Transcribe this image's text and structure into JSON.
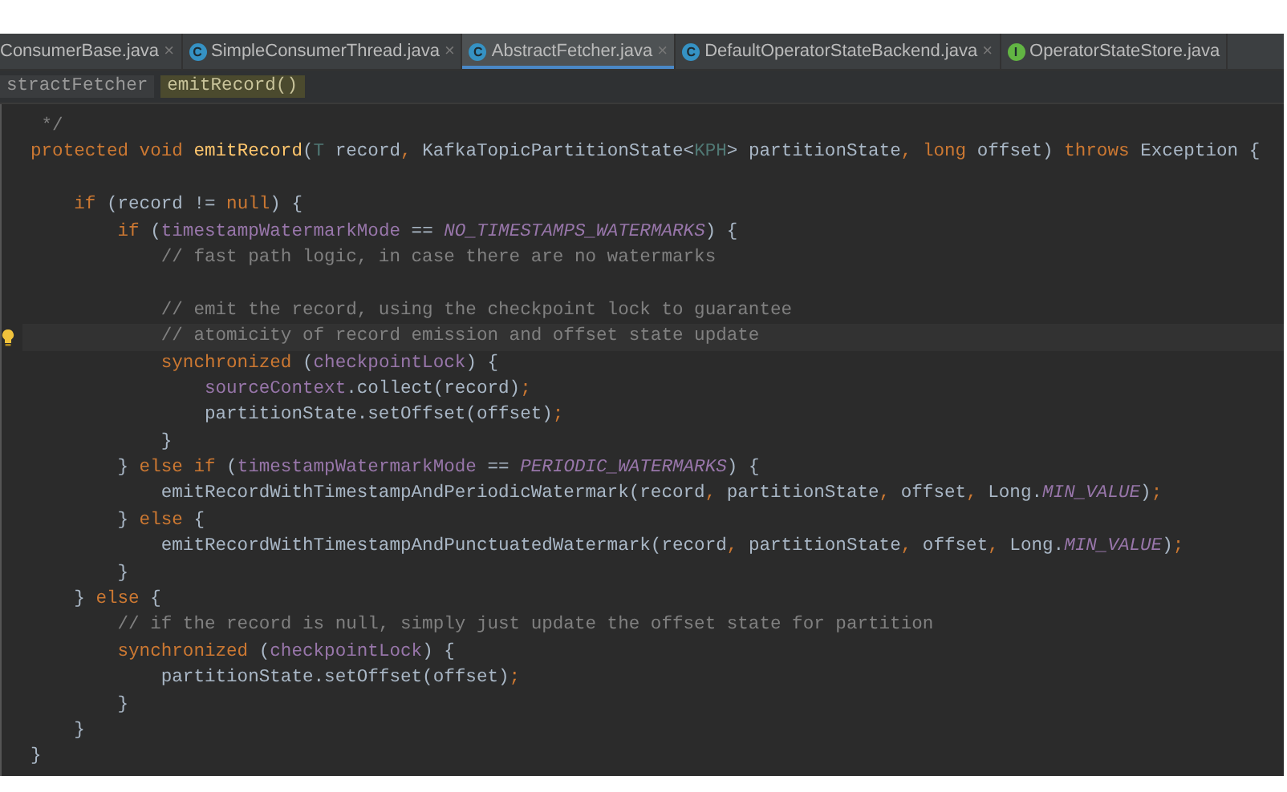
{
  "tabs": [
    {
      "label": "ConsumerBase.java",
      "kind": "plain",
      "close": "×",
      "selected": false
    },
    {
      "label": "SimpleConsumerThread.java",
      "kind": "class",
      "icon": "C",
      "close": "×",
      "selected": false
    },
    {
      "label": "AbstractFetcher.java",
      "kind": "class",
      "icon": "C",
      "close": "×",
      "selected": true
    },
    {
      "label": "DefaultOperatorStateBackend.java",
      "kind": "class",
      "icon": "C",
      "close": "×",
      "selected": false
    },
    {
      "label": "OperatorStateStore.java",
      "kind": "interface",
      "icon": "I",
      "selected": false
    }
  ],
  "breadcrumb": [
    {
      "label": "stractFetcher",
      "selected": false
    },
    {
      "label": "emitRecord()",
      "selected": true
    }
  ],
  "code": {
    "lines": [
      {
        "kind": "code",
        "tokens": [
          {
            "kind": "comment",
            "text": " */"
          }
        ]
      },
      {
        "kind": "code",
        "tokens": [
          {
            "kind": "kw",
            "text": "protected void "
          },
          {
            "kind": "decl",
            "text": "emitRecord"
          },
          {
            "kind": "plain",
            "text": "("
          },
          {
            "kind": "param",
            "text": "T"
          },
          {
            "kind": "plain",
            "text": " record"
          },
          {
            "kind": "punct",
            "text": ", "
          },
          {
            "kind": "plain",
            "text": "KafkaTopicPartitionState<"
          },
          {
            "kind": "param",
            "text": "KPH"
          },
          {
            "kind": "plain",
            "text": "> partitionState"
          },
          {
            "kind": "punct",
            "text": ", "
          },
          {
            "kind": "kw",
            "text": "long "
          },
          {
            "kind": "plain",
            "text": "offset) "
          },
          {
            "kind": "kw",
            "text": "throws "
          },
          {
            "kind": "plain",
            "text": "Exception {"
          }
        ]
      },
      {
        "kind": "blank"
      },
      {
        "kind": "code",
        "tokens": [
          {
            "kind": "kw",
            "text": "    if "
          },
          {
            "kind": "plain",
            "text": "(record != "
          },
          {
            "kind": "kw",
            "text": "null"
          },
          {
            "kind": "plain",
            "text": ") {"
          }
        ]
      },
      {
        "kind": "code",
        "tokens": [
          {
            "kind": "kw",
            "text": "        if "
          },
          {
            "kind": "plain",
            "text": "("
          },
          {
            "kind": "field",
            "text": "timestampWatermarkMode"
          },
          {
            "kind": "plain",
            "text": " == "
          },
          {
            "kind": "const",
            "text": "NO_TIMESTAMPS_WATERMARKS"
          },
          {
            "kind": "plain",
            "text": ") {"
          }
        ]
      },
      {
        "kind": "code",
        "tokens": [
          {
            "kind": "comment",
            "text": "            // fast path logic, in case there are no watermarks"
          }
        ]
      },
      {
        "kind": "blank"
      },
      {
        "kind": "code",
        "tokens": [
          {
            "kind": "comment",
            "text": "            // emit the record, using the checkpoint lock to guarantee"
          }
        ]
      },
      {
        "kind": "code",
        "current": true,
        "tokens": [
          {
            "kind": "comment",
            "text": "            // atomicity of record emission and offset state update"
          }
        ]
      },
      {
        "kind": "code",
        "tokens": [
          {
            "kind": "kw",
            "text": "            synchronized "
          },
          {
            "kind": "plain",
            "text": "("
          },
          {
            "kind": "field",
            "text": "checkpointLock"
          },
          {
            "kind": "plain",
            "text": ") {"
          }
        ]
      },
      {
        "kind": "code",
        "tokens": [
          {
            "kind": "field",
            "text": "                sourceContext"
          },
          {
            "kind": "plain",
            "text": ".collect(record)"
          },
          {
            "kind": "punct",
            "text": ";"
          }
        ]
      },
      {
        "kind": "code",
        "tokens": [
          {
            "kind": "plain",
            "text": "                partitionState.setOffset(offset)"
          },
          {
            "kind": "punct",
            "text": ";"
          }
        ]
      },
      {
        "kind": "code",
        "tokens": [
          {
            "kind": "plain",
            "text": "            }"
          }
        ]
      },
      {
        "kind": "code",
        "tokens": [
          {
            "kind": "plain",
            "text": "        } "
          },
          {
            "kind": "kw",
            "text": "else if "
          },
          {
            "kind": "plain",
            "text": "("
          },
          {
            "kind": "field",
            "text": "timestampWatermarkMode"
          },
          {
            "kind": "plain",
            "text": " == "
          },
          {
            "kind": "const",
            "text": "PERIODIC_WATERMARKS"
          },
          {
            "kind": "plain",
            "text": ") {"
          }
        ]
      },
      {
        "kind": "code",
        "tokens": [
          {
            "kind": "plain",
            "text": "            emitRecordWithTimestampAndPeriodicWatermark(record"
          },
          {
            "kind": "punct",
            "text": ", "
          },
          {
            "kind": "plain",
            "text": "partitionState"
          },
          {
            "kind": "punct",
            "text": ", "
          },
          {
            "kind": "plain",
            "text": "offset"
          },
          {
            "kind": "punct",
            "text": ", "
          },
          {
            "kind": "plain",
            "text": "Long."
          },
          {
            "kind": "const",
            "text": "MIN_VALUE"
          },
          {
            "kind": "plain",
            "text": ")"
          },
          {
            "kind": "punct",
            "text": ";"
          }
        ]
      },
      {
        "kind": "code",
        "tokens": [
          {
            "kind": "plain",
            "text": "        } "
          },
          {
            "kind": "kw",
            "text": "else "
          },
          {
            "kind": "plain",
            "text": "{"
          }
        ]
      },
      {
        "kind": "code",
        "tokens": [
          {
            "kind": "plain",
            "text": "            emitRecordWithTimestampAndPunctuatedWatermark(record"
          },
          {
            "kind": "punct",
            "text": ", "
          },
          {
            "kind": "plain",
            "text": "partitionState"
          },
          {
            "kind": "punct",
            "text": ", "
          },
          {
            "kind": "plain",
            "text": "offset"
          },
          {
            "kind": "punct",
            "text": ", "
          },
          {
            "kind": "plain",
            "text": "Long."
          },
          {
            "kind": "const",
            "text": "MIN_VALUE"
          },
          {
            "kind": "plain",
            "text": ")"
          },
          {
            "kind": "punct",
            "text": ";"
          }
        ]
      },
      {
        "kind": "code",
        "tokens": [
          {
            "kind": "plain",
            "text": "        }"
          }
        ]
      },
      {
        "kind": "code",
        "tokens": [
          {
            "kind": "plain",
            "text": "    } "
          },
          {
            "kind": "kw",
            "text": "else "
          },
          {
            "kind": "plain",
            "text": "{"
          }
        ]
      },
      {
        "kind": "code",
        "tokens": [
          {
            "kind": "comment",
            "text": "        // if the record is null, simply just update the offset state for partition"
          }
        ]
      },
      {
        "kind": "code",
        "tokens": [
          {
            "kind": "kw",
            "text": "        synchronized "
          },
          {
            "kind": "plain",
            "text": "("
          },
          {
            "kind": "field",
            "text": "checkpointLock"
          },
          {
            "kind": "plain",
            "text": ") {"
          }
        ]
      },
      {
        "kind": "code",
        "tokens": [
          {
            "kind": "plain",
            "text": "            partitionState.setOffset(offset)"
          },
          {
            "kind": "punct",
            "text": ";"
          }
        ]
      },
      {
        "kind": "code",
        "tokens": [
          {
            "kind": "plain",
            "text": "        }"
          }
        ]
      },
      {
        "kind": "code",
        "tokens": [
          {
            "kind": "plain",
            "text": "    }"
          }
        ]
      },
      {
        "kind": "code",
        "tokens": [
          {
            "kind": "plain",
            "text": "}"
          }
        ]
      }
    ]
  }
}
